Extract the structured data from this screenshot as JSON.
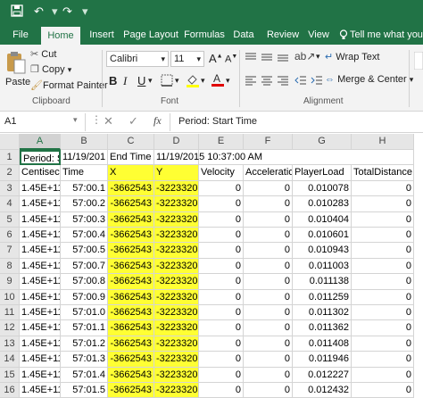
{
  "titlebar": {
    "undo_icon": "undo-icon",
    "redo_icon": "redo-icon",
    "save_icon": "save-icon"
  },
  "tabs": [
    {
      "label": "File"
    },
    {
      "label": "Home"
    },
    {
      "label": "Insert"
    },
    {
      "label": "Page Layout"
    },
    {
      "label": "Formulas"
    },
    {
      "label": "Data"
    },
    {
      "label": "Review"
    },
    {
      "label": "View"
    }
  ],
  "tell_me": "Tell me what you",
  "ribbon": {
    "paste": "Paste",
    "cut": "Cut",
    "copy": "Copy",
    "format_painter": "Format Painter",
    "clipboard_label": "Clipboard",
    "font_name": "Calibri",
    "font_size": "11",
    "bold": "B",
    "italic": "I",
    "underline": "U",
    "font_label": "Font",
    "wrap_text": "Wrap Text",
    "merge_center": "Merge & Center",
    "alignment_label": "Alignment"
  },
  "formula_bar": {
    "name_box": "A1",
    "fx": "fx",
    "content": "Period: Start Time"
  },
  "columns": [
    "A",
    "B",
    "C",
    "D",
    "E",
    "F",
    "G",
    "H"
  ],
  "rows": [
    {
      "n": "1",
      "cells": [
        "Period: Sta",
        "11/19/201",
        "End Time",
        "11/19/2015 10:37:00 AM",
        "",
        "",
        "",
        ""
      ]
    },
    {
      "n": "2",
      "cells": [
        "Centisec",
        "Time",
        "X",
        "Y",
        "Velocity",
        "Acceleratio",
        "PlayerLoad",
        "TotalDistance"
      ]
    },
    {
      "n": "3",
      "cells": [
        "1.45E+11",
        "57:00.1",
        "-3662543",
        "-3223320",
        "0",
        "0",
        "0.010078",
        "0"
      ]
    },
    {
      "n": "4",
      "cells": [
        "1.45E+11",
        "57:00.2",
        "-3662543",
        "-3223320",
        "0",
        "0",
        "0.010283",
        "0"
      ]
    },
    {
      "n": "5",
      "cells": [
        "1.45E+11",
        "57:00.3",
        "-3662543",
        "-3223320",
        "0",
        "0",
        "0.010404",
        "0"
      ]
    },
    {
      "n": "6",
      "cells": [
        "1.45E+11",
        "57:00.4",
        "-3662543",
        "-3223320",
        "0",
        "0",
        "0.010601",
        "0"
      ]
    },
    {
      "n": "7",
      "cells": [
        "1.45E+11",
        "57:00.5",
        "-3662543",
        "-3223320",
        "0",
        "0",
        "0.010943",
        "0"
      ]
    },
    {
      "n": "8",
      "cells": [
        "1.45E+11",
        "57:00.7",
        "-3662543",
        "-3223320",
        "0",
        "0",
        "0.011003",
        "0"
      ]
    },
    {
      "n": "9",
      "cells": [
        "1.45E+11",
        "57:00.8",
        "-3662543",
        "-3223320",
        "0",
        "0",
        "0.011138",
        "0"
      ]
    },
    {
      "n": "10",
      "cells": [
        "1.45E+11",
        "57:00.9",
        "-3662543",
        "-3223320",
        "0",
        "0",
        "0.011259",
        "0"
      ]
    },
    {
      "n": "11",
      "cells": [
        "1.45E+11",
        "57:01.0",
        "-3662543",
        "-3223320",
        "0",
        "0",
        "0.011302",
        "0"
      ]
    },
    {
      "n": "12",
      "cells": [
        "1.45E+11",
        "57:01.1",
        "-3662543",
        "-3223320",
        "0",
        "0",
        "0.011362",
        "0"
      ]
    },
    {
      "n": "13",
      "cells": [
        "1.45E+11",
        "57:01.2",
        "-3662543",
        "-3223320",
        "0",
        "0",
        "0.011408",
        "0"
      ]
    },
    {
      "n": "14",
      "cells": [
        "1.45E+11",
        "57:01.3",
        "-3662543",
        "-3223320",
        "0",
        "0",
        "0.011946",
        "0"
      ]
    },
    {
      "n": "15",
      "cells": [
        "1.45E+11",
        "57:01.4",
        "-3662543",
        "-3223320",
        "0",
        "0",
        "0.012227",
        "0"
      ]
    },
    {
      "n": "16",
      "cells": [
        "1.45E+11",
        "57:01.5",
        "-3662543",
        "-3223320",
        "0",
        "0",
        "0.012432",
        "0"
      ]
    }
  ],
  "colors": {
    "excel_green": "#217346",
    "highlight": "#ffff33"
  }
}
